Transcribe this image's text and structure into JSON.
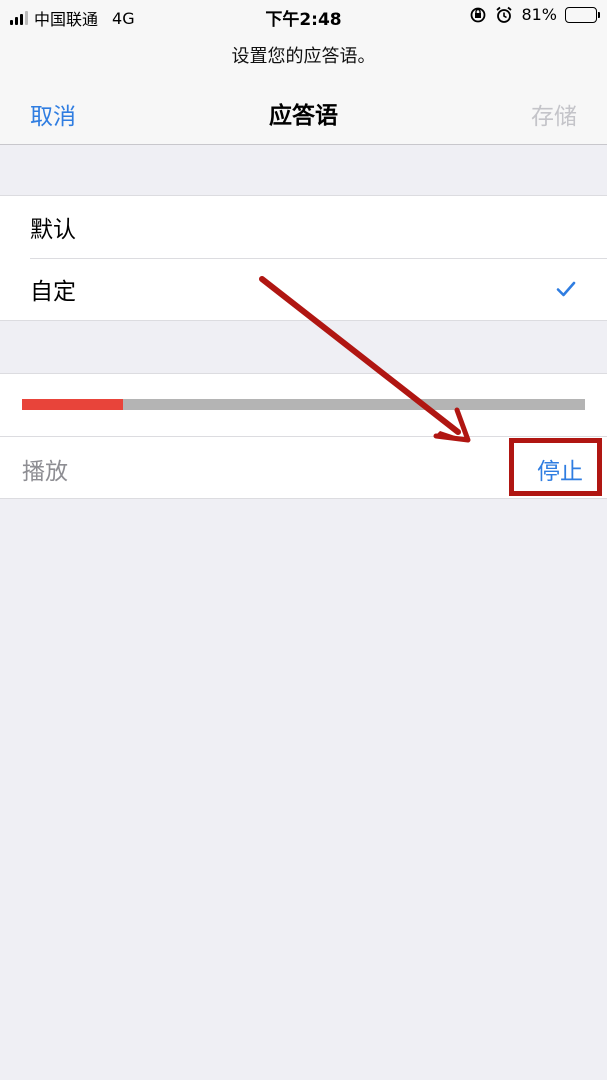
{
  "status_bar": {
    "carrier": "中国联通",
    "network": "4G",
    "time": "下午2:48",
    "battery_percent": "81%",
    "battery_level": 0.81
  },
  "nav": {
    "prompt": "设置您的应答语。",
    "cancel_label": "取消",
    "title": "应答语",
    "save_label": "存储"
  },
  "options": [
    {
      "label": "默认",
      "selected": false
    },
    {
      "label": "自定",
      "selected": true
    }
  ],
  "playback": {
    "progress": 0.18,
    "play_label": "播放",
    "stop_label": "停止"
  },
  "colors": {
    "accent": "#2f7de1",
    "progress_done": "#e8443a",
    "progress_track": "#b4b4b4",
    "annotation": "#b01612"
  }
}
